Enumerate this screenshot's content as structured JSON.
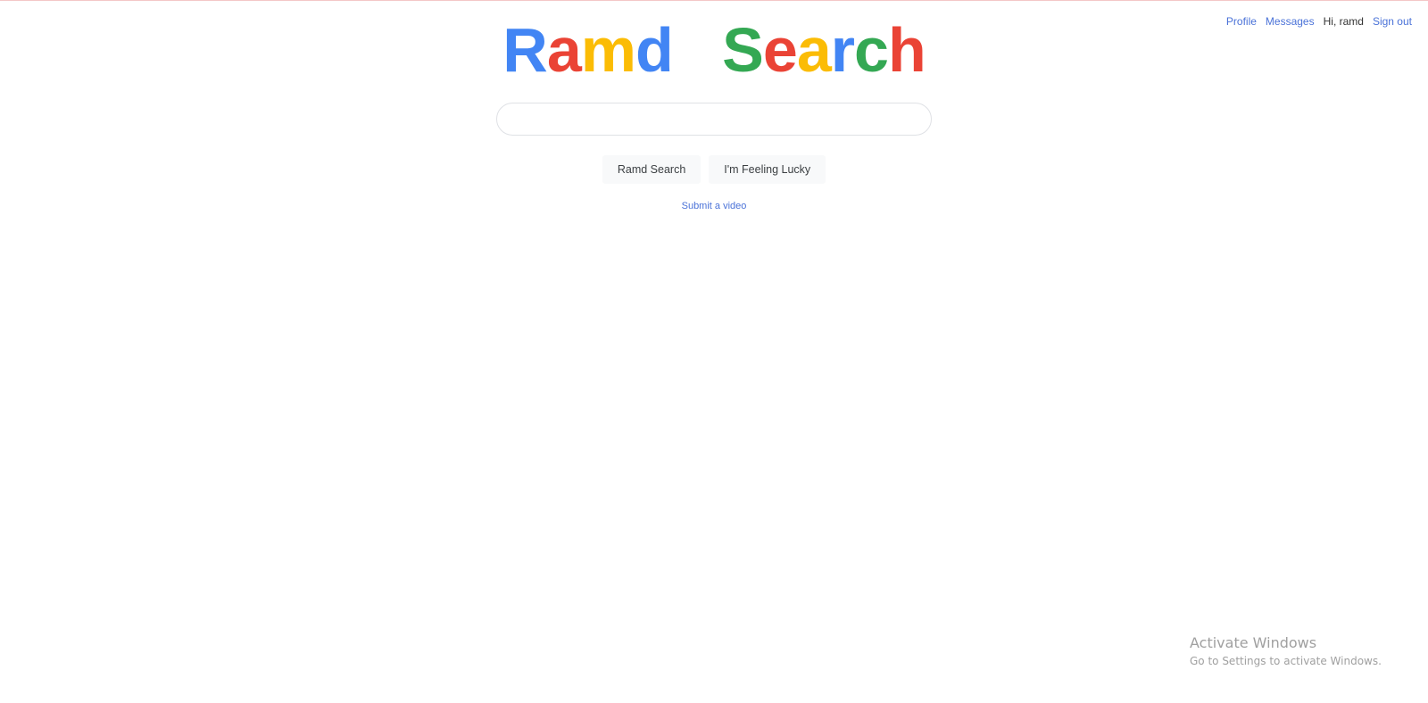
{
  "nav": {
    "profile": "Profile",
    "messages": "Messages",
    "greeting": "Hi, ramd",
    "signout": "Sign out",
    "link_color": "#4a72d8"
  },
  "logo": {
    "letters": [
      {
        "char": "R",
        "color": "#4285f4"
      },
      {
        "char": "a",
        "color": "#ea4335"
      },
      {
        "char": "m",
        "color": "#fbbc05"
      },
      {
        "char": "d",
        "color": "#4285f4"
      },
      {
        "char": "   ",
        "color": "#ffffff"
      },
      {
        "char": "S",
        "color": "#34a853"
      },
      {
        "char": "e",
        "color": "#ea4335"
      },
      {
        "char": "a",
        "color": "#fbbc05"
      },
      {
        "char": "r",
        "color": "#4285f4"
      },
      {
        "char": "c",
        "color": "#34a853"
      },
      {
        "char": "h",
        "color": "#ea4335"
      }
    ]
  },
  "search": {
    "value": "",
    "placeholder": ""
  },
  "buttons": {
    "search_label": "Ramd Search",
    "lucky_label": "I'm Feeling Lucky"
  },
  "links": {
    "submit_video": "Submit a video"
  },
  "watermark": {
    "title": "Activate Windows",
    "subtitle": "Go to Settings to activate Windows."
  }
}
